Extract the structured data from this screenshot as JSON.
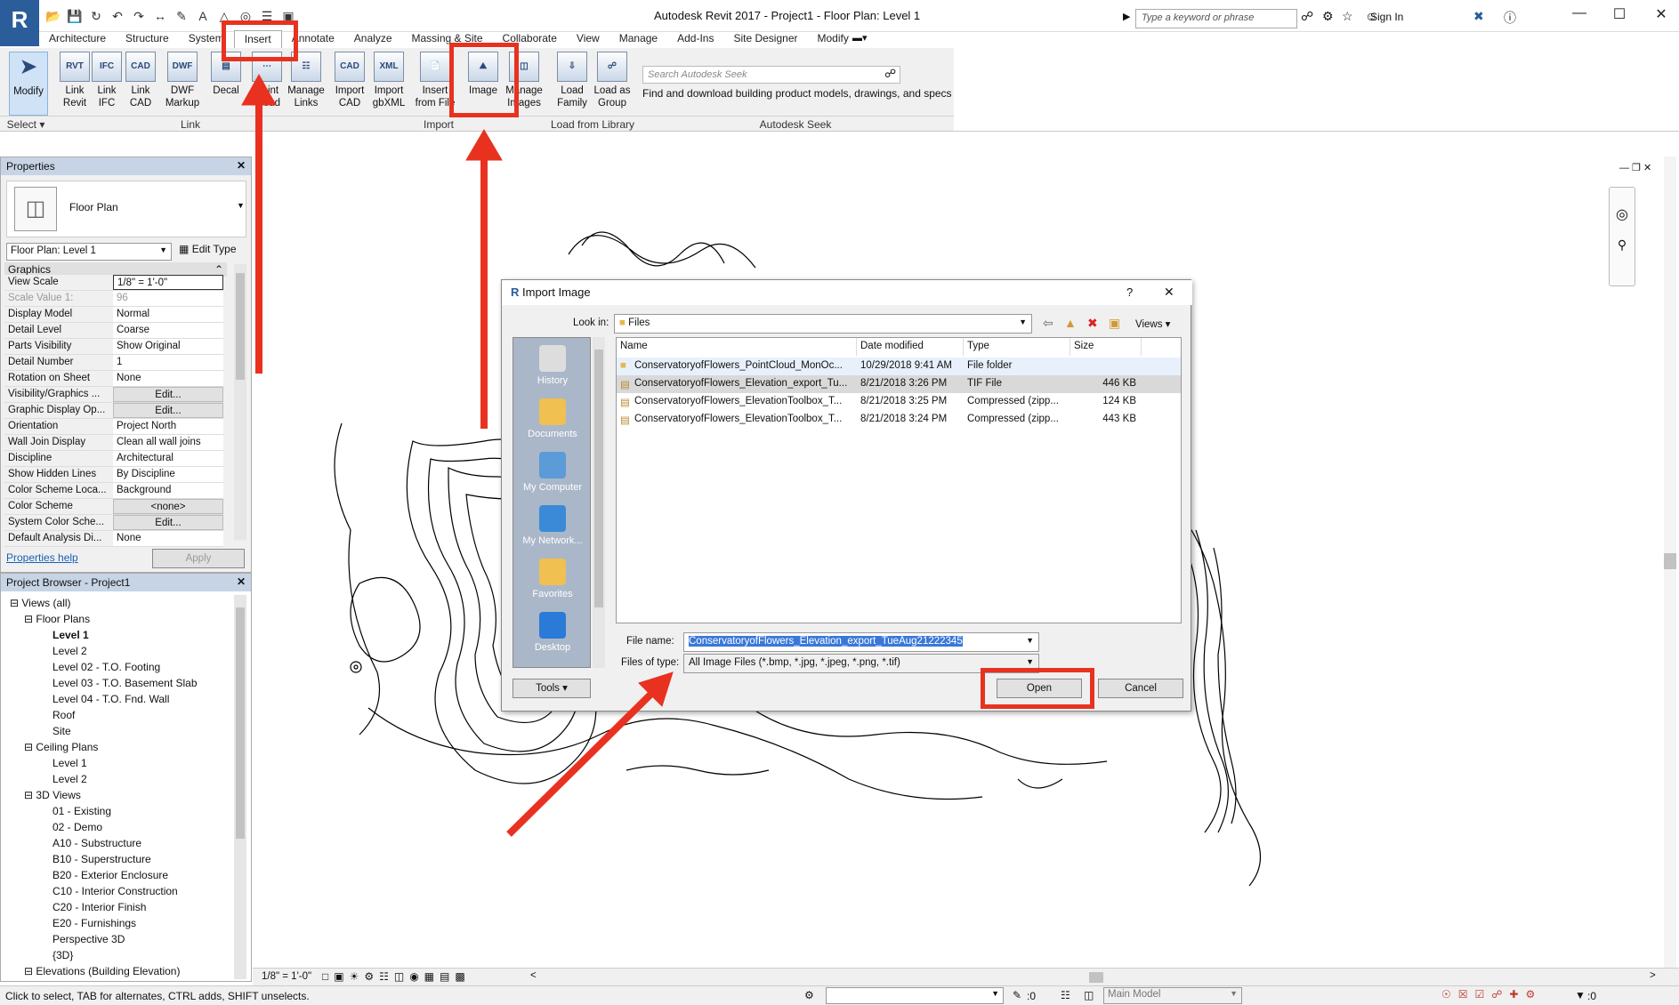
{
  "app": {
    "logo": "R",
    "title": "Autodesk Revit 2017 -      Project1 - Floor Plan: Level 1",
    "search_placeholder": "Type a keyword or phrase",
    "sign_in": "Sign In"
  },
  "tabs": [
    "Architecture",
    "Structure",
    "System",
    "Insert",
    "Annotate",
    "Analyze",
    "Massing & Site",
    "Collaborate",
    "View",
    "Manage",
    "Add-Ins",
    "Site Designer",
    "Modify"
  ],
  "ribbon": {
    "modify": "Modify",
    "select_label": "Select",
    "link_revit": [
      "Link",
      "Revit"
    ],
    "link_ifc": [
      "Link",
      "IFC"
    ],
    "link_cad": [
      "Link",
      "CAD"
    ],
    "dwf_markup": [
      "DWF",
      "Markup"
    ],
    "decal": "Decal",
    "point_cloud": [
      "Point",
      "Cloud"
    ],
    "manage_links": [
      "Manage",
      "Links"
    ],
    "import_cad": [
      "Import",
      "CAD"
    ],
    "import_gbxml": [
      "Import",
      "gbXML"
    ],
    "insert_from_file": [
      "Insert",
      "from File"
    ],
    "image": "Image",
    "manage_images": [
      "Manage",
      "Images"
    ],
    "load_family": [
      "Load",
      "Family"
    ],
    "load_as_group": [
      "Load as",
      "Group"
    ],
    "panel_link": "Link",
    "panel_import": "Import",
    "panel_load": "Load from Library",
    "panel_seek": "Autodesk Seek",
    "seek_placeholder": "Search Autodesk Seek",
    "seek_desc": "Find and download building product models, drawings, and specs"
  },
  "properties": {
    "title": "Properties",
    "type_name": "Floor Plan",
    "instance_select": "Floor Plan: Level 1",
    "edit_type": "Edit Type",
    "section": "Graphics",
    "rows": [
      {
        "k": "View Scale",
        "v": "1/8\" = 1'-0\""
      },
      {
        "k": "Scale Value    1:",
        "v": "96"
      },
      {
        "k": "Display Model",
        "v": "Normal"
      },
      {
        "k": "Detail Level",
        "v": "Coarse"
      },
      {
        "k": "Parts Visibility",
        "v": "Show Original"
      },
      {
        "k": "Detail Number",
        "v": "1"
      },
      {
        "k": "Rotation on Sheet",
        "v": "None"
      },
      {
        "k": "Visibility/Graphics ...",
        "v": "Edit..."
      },
      {
        "k": "Graphic Display Op...",
        "v": "Edit..."
      },
      {
        "k": "Orientation",
        "v": "Project North"
      },
      {
        "k": "Wall Join Display",
        "v": "Clean all wall joins"
      },
      {
        "k": "Discipline",
        "v": "Architectural"
      },
      {
        "k": "Show Hidden Lines",
        "v": "By Discipline"
      },
      {
        "k": "Color Scheme Loca...",
        "v": "Background"
      },
      {
        "k": "Color Scheme",
        "v": "<none>"
      },
      {
        "k": "System Color Sche...",
        "v": "Edit..."
      },
      {
        "k": "Default Analysis Di...",
        "v": "None"
      }
    ],
    "help": "Properties help",
    "apply": "Apply"
  },
  "browser": {
    "title": "Project Browser - Project1",
    "items": [
      {
        "t": "Views (all)",
        "lvl": 0
      },
      {
        "t": "Floor Plans",
        "lvl": 1
      },
      {
        "t": "Level 1",
        "lvl": 2,
        "bold": true
      },
      {
        "t": "Level 2",
        "lvl": 2
      },
      {
        "t": "Level 02 - T.O. Footing",
        "lvl": 2
      },
      {
        "t": "Level 03 - T.O. Basement Slab",
        "lvl": 2
      },
      {
        "t": "Level 04 - T.O. Fnd. Wall",
        "lvl": 2
      },
      {
        "t": "Roof",
        "lvl": 2
      },
      {
        "t": "Site",
        "lvl": 2
      },
      {
        "t": "Ceiling Plans",
        "lvl": 1
      },
      {
        "t": "Level 1",
        "lvl": 2
      },
      {
        "t": "Level 2",
        "lvl": 2
      },
      {
        "t": "3D Views",
        "lvl": 1
      },
      {
        "t": "01 - Existing",
        "lvl": 2
      },
      {
        "t": "02 - Demo",
        "lvl": 2
      },
      {
        "t": "A10 - Substructure",
        "lvl": 2
      },
      {
        "t": "B10 - Superstructure",
        "lvl": 2
      },
      {
        "t": "B20 - Exterior Enclosure",
        "lvl": 2
      },
      {
        "t": "C10 - Interior Construction",
        "lvl": 2
      },
      {
        "t": "C20 - Interior Finish",
        "lvl": 2
      },
      {
        "t": "E20 - Furnishings",
        "lvl": 2
      },
      {
        "t": "Perspective 3D",
        "lvl": 2
      },
      {
        "t": "{3D}",
        "lvl": 2
      },
      {
        "t": "Elevations (Building Elevation)",
        "lvl": 1
      }
    ]
  },
  "dialog": {
    "title": "Import Image",
    "look_in_label": "Look in:",
    "look_in_value": "Files",
    "views": "Views",
    "places": [
      "History",
      "Documents",
      "My Computer",
      "My Network...",
      "Favorites",
      "Desktop"
    ],
    "columns": [
      "Name",
      "Date modified",
      "Type",
      "Size"
    ],
    "files": [
      {
        "name": "ConservatoryofFlowers_PointCloud_MonOc...",
        "date": "10/29/2018 9:41 AM",
        "type": "File folder",
        "size": ""
      },
      {
        "name": "ConservatoryofFlowers_Elevation_export_Tu...",
        "date": "8/21/2018 3:26 PM",
        "type": "TIF File",
        "size": "446 KB"
      },
      {
        "name": "ConservatoryofFlowers_ElevationToolbox_T...",
        "date": "8/21/2018 3:25 PM",
        "type": "Compressed (zipp...",
        "size": "124 KB"
      },
      {
        "name": "ConservatoryofFlowers_ElevationToolbox_T...",
        "date": "8/21/2018 3:24 PM",
        "type": "Compressed (zipp...",
        "size": "443 KB"
      }
    ],
    "file_name_label": "File name:",
    "file_name_value": "ConservatoryofFlowers_Elevation_export_TueAug21222345",
    "files_of_type_label": "Files of type:",
    "files_of_type_value": "All Image Files (*.bmp, *.jpg, *.jpeg, *.png, *.tif)",
    "tools": "Tools",
    "open": "Open",
    "cancel": "Cancel"
  },
  "viewbar": {
    "scale": "1/8\" = 1'-0\""
  },
  "status": {
    "hint": "Click to select, TAB for alternates, CTRL adds, SHIFT unselects.",
    "count": ":0",
    "model": "Main Model",
    "filter_count": ":0"
  },
  "colors": {
    "accent": "#e8321f",
    "brand": "#2a5d9a",
    "selected": "#3a78d8"
  }
}
